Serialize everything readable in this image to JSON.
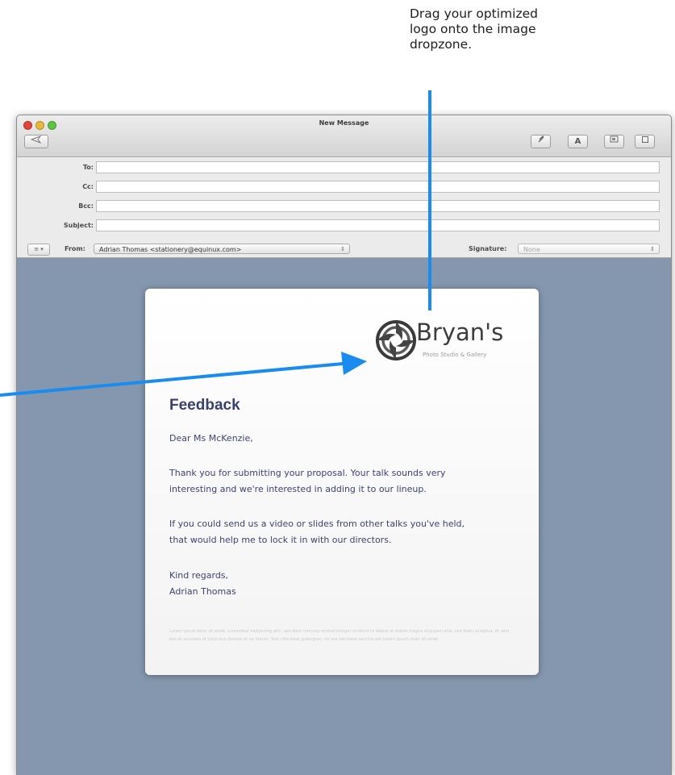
{
  "callout": {
    "line1": "Drag your optimized",
    "line2": "logo onto the image",
    "line3": "dropzone."
  },
  "window": {
    "title": "New Message",
    "send_icon": "send-arrow-icon",
    "format_buttons": [
      "attach-icon",
      "font-icon",
      "photo-browser-icon",
      "stationery-icon"
    ]
  },
  "header": {
    "to_label": "To:",
    "cc_label": "Cc:",
    "bcc_label": "Bcc:",
    "subject_label": "Subject:",
    "to_value": "",
    "cc_value": "",
    "bcc_value": "",
    "subject_value": "",
    "from_label": "From:",
    "from_value": "Adrian Thomas <stationery@equinux.com>",
    "signature_label": "Signature:",
    "signature_value": "None"
  },
  "letter": {
    "brand_name": "Bryan's",
    "brand_tagline": "Photo Studio & Gallery",
    "title": "Feedback",
    "greeting": "Dear Ms McKenzie,",
    "para1_l1": "Thank you for submitting your proposal. Your talk sounds very",
    "para1_l2": "interesting and we're interested in adding it to our lineup.",
    "para2_l1": "If you could send us a video or slides from other talks you've held,",
    "para2_l2": "that would help me to lock it in with our directors.",
    "closing": "Kind regards,",
    "signature": "Adrian Thomas",
    "lorem": "Lorem ipsum dolor sit amet, consetetur sadipscing elitr, sed diam nonumy eirmod tempor invidunt ut labore et dolore magna aliquyam erat, sed diam voluptua. At vero eos et accusam et justo duo dolores et ea rebum. Stet clita kasd gubergren, no sea takimata sanctus est Lorem ipsum dolor sit amet."
  },
  "colors": {
    "arrow": "#1a8cf0",
    "canvas": "#8597ae",
    "heading": "#3b3f6e"
  }
}
